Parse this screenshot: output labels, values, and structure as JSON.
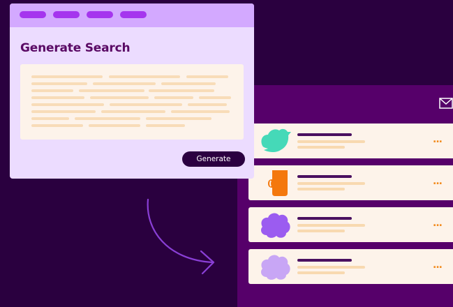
{
  "generate_window": {
    "title": "Generate Search",
    "generate_button_label": "Generate"
  },
  "email_panel": {
    "icon": "envelope-icon",
    "rows": [
      {
        "avatar": "bird-icon",
        "avatar_color": "#45d9b8",
        "more_label": "..."
      },
      {
        "avatar": "cup-icon",
        "avatar_color": "#f4780d",
        "more_label": "..."
      },
      {
        "avatar": "cloud-icon",
        "avatar_color": "#9b5cf0",
        "more_label": "..."
      },
      {
        "avatar": "cloud-icon",
        "avatar_color": "#c8a6f5",
        "more_label": "..."
      }
    ]
  },
  "colors": {
    "background": "#2a003f",
    "panel": "#56006a",
    "window_body": "#ecdcff",
    "window_titlebar": "#d3a9ff",
    "titlebar_pills": "#a535ee",
    "accent_orange": "#f28a1b",
    "button": "#2b0040"
  }
}
